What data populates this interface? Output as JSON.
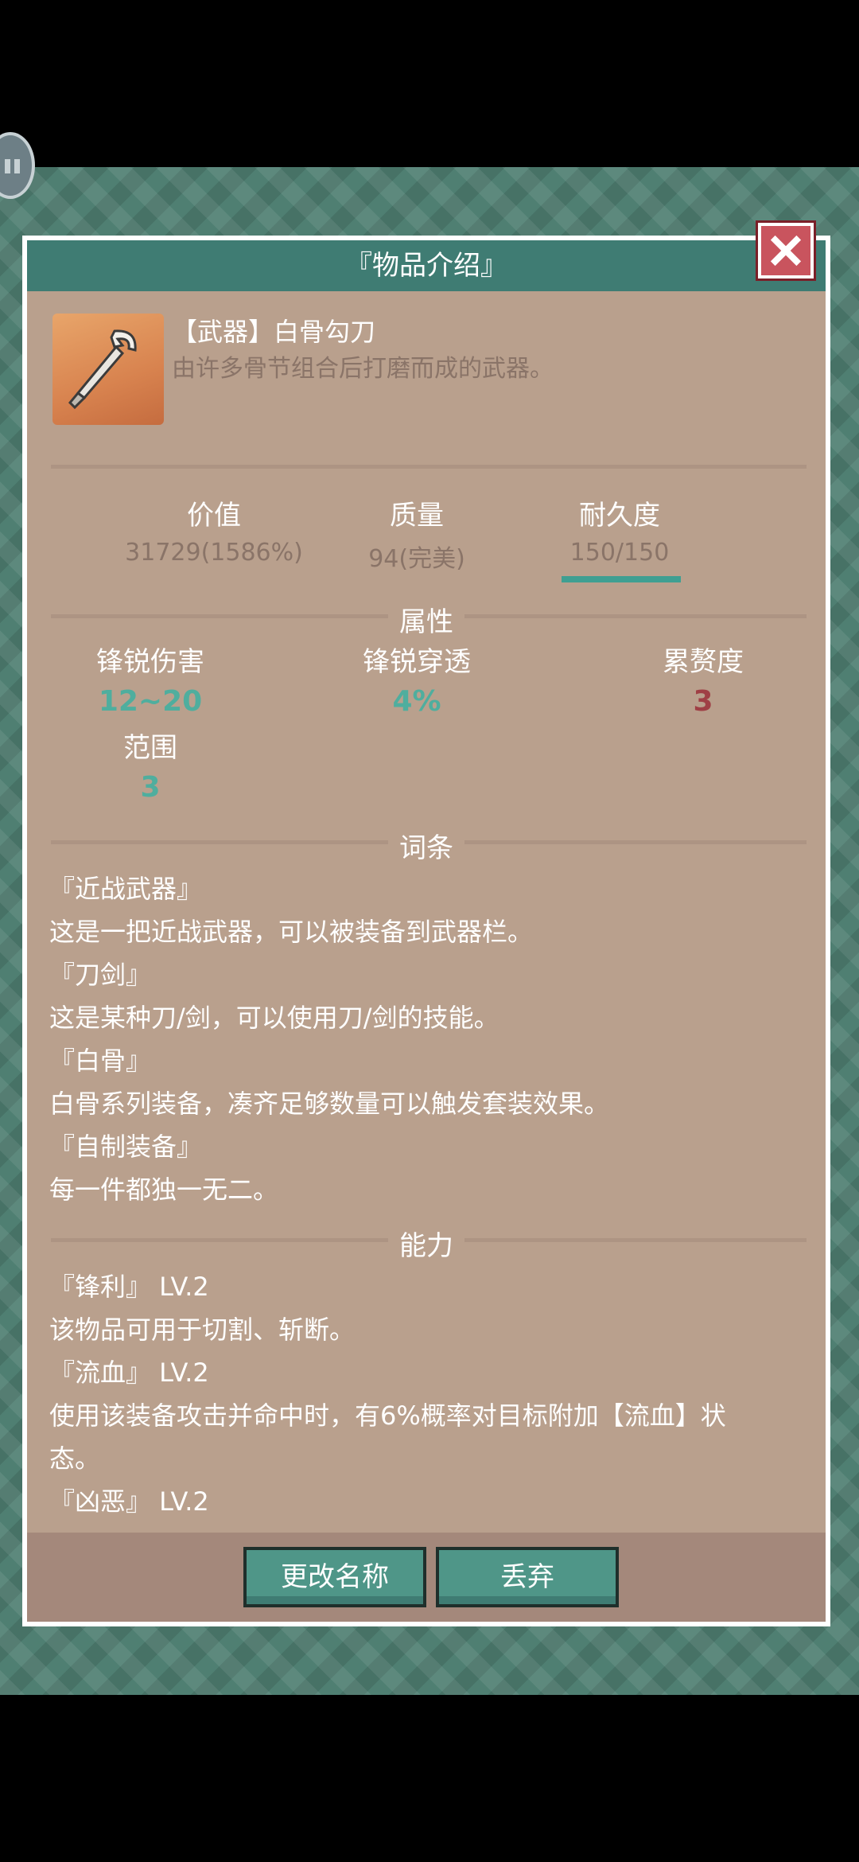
{
  "dialog": {
    "title": "『物品介绍』",
    "item": {
      "name": "【武器】白骨勾刀",
      "description": "由许多骨节组合后打磨而成的武器。",
      "icon": "bone-hook-blade-icon"
    },
    "stats": [
      {
        "label": "价值",
        "value": "31729(1586%)"
      },
      {
        "label": "质量",
        "value": "94(完美)"
      },
      {
        "label": "耐久度",
        "value": "150/150",
        "fill_percent": 100
      }
    ],
    "attributes": {
      "title": "属性",
      "items": [
        {
          "label": "锋锐伤害",
          "value": "12~20",
          "color": "#4fae9e"
        },
        {
          "label": "锋锐穿透",
          "value": "4%",
          "color": "#4fae9e"
        },
        {
          "label": "累赘度",
          "value": "3",
          "color": "#9f3f45"
        },
        {
          "label": "范围",
          "value": "3",
          "color": "#4fae9e"
        }
      ]
    },
    "affixes": {
      "title": "词条",
      "lines": [
        "『近战武器』",
        "这是一把近战武器，可以被装备到武器栏。",
        "『刀剑』",
        "这是某种刀/剑，可以使用刀/剑的技能。",
        "『白骨』",
        "白骨系列装备，凑齐足够数量可以触发套装效果。",
        "『自制装备』",
        "每一件都独一无二。"
      ]
    },
    "abilities": {
      "title": "能力",
      "lines": [
        "『锋利』 LV.2",
        "该物品可用于切割、斩断。",
        "『流血』 LV.2",
        "使用该装备攻击并命中时，有6%概率对目标附加【流血】状",
        "态。",
        "『凶恶』 LV.2"
      ]
    },
    "buttons": {
      "rename": "更改名称",
      "discard": "丢弃"
    }
  }
}
